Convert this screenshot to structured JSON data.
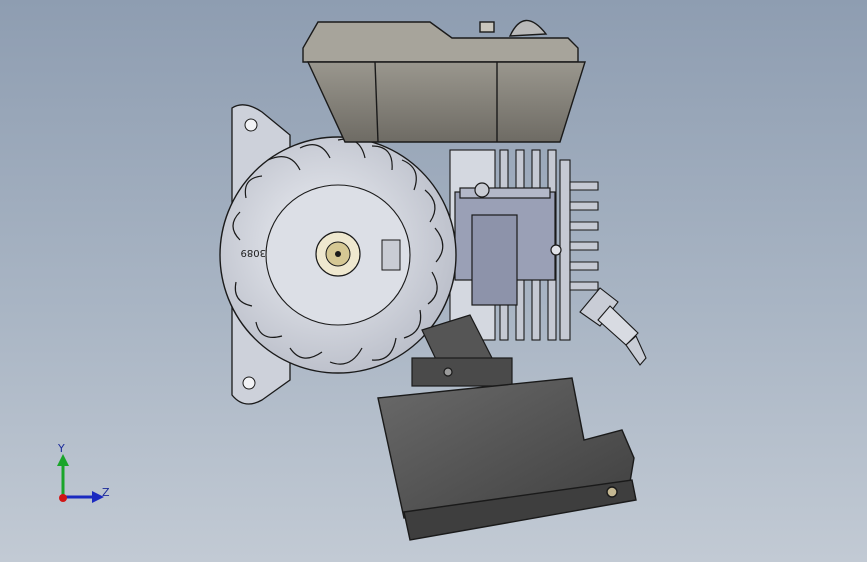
{
  "viewport": {
    "background_top": "#8e9db1",
    "background_bottom": "#c2cad4"
  },
  "model": {
    "flywheel_text": "3089"
  },
  "triad": {
    "y_label": "Y",
    "z_label": "Z",
    "y_color": "#1aa52a",
    "z_color": "#1b2ac0",
    "x_color": "#d01616"
  },
  "colors": {
    "metal_light": "#cfd3dc",
    "metal_mid": "#a9aebb",
    "tank_fill": "#7d7a72",
    "air_filter": "#555555",
    "outline": "#1a1a1a"
  }
}
